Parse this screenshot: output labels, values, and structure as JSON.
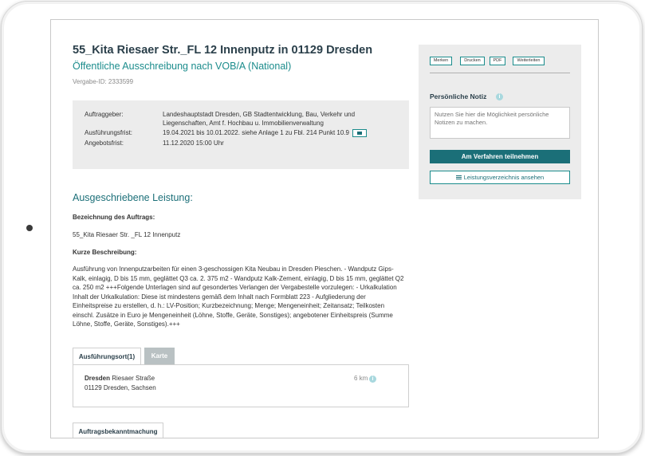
{
  "header": {
    "title": "55_Kita Riesaer Str._FL 12 Innenputz in 01129 Dresden",
    "subtitle": "Öffentliche Ausschreibung nach VOB/A (National)",
    "vergabe_id": "Vergabe-ID: 2333599"
  },
  "info": {
    "auftraggeber_label": "Auftraggeber:",
    "auftraggeber_line1": "Landeshauptstadt Dresden, GB Stadtentwicklung, Bau, Verkehr und",
    "auftraggeber_line2": "Liegenschaften, Amt f. Hochbau u. Immobilienverwaltung",
    "frist_label": "Ausführungsfrist:",
    "frist_value": "19.04.2021 bis 10.01.2022. siehe Anlage 1 zu Fbl. 214 Punkt 10.9",
    "angebot_label": "Angebotsfrist:",
    "angebot_value": "11.12.2020 15:00 Uhr"
  },
  "leistung": {
    "section_title": "Ausgeschriebene Leistung:",
    "bezeichnung_label": "Bezeichnung des Auftrags:",
    "bezeichnung_value": "55_Kita Riesaer Str. _FL 12 Innenputz",
    "kurz_label": "Kurze Beschreibung:",
    "kurz_text": "Ausführung von Innenputzarbeiten für einen 3-geschossigen Kita Neubau in Dresden Pieschen. - Wandputz Gips-Kalk, einlagig, D bis 15 mm, geglättet Q3 ca. 2. 375 m2 - Wandputz Kalk-Zement, einlagig, D bis 15 mm, geglättet Q2 ca. 250 m2 +++Folgende Unterlagen sind auf gesondertes Verlangen der Vergabestelle vorzulegen: - Urkalkulation Inhalt der Urkalkulation: Diese ist mindestens gemäß dem Inhalt nach Formblatt 223 - Aufgliederung der Einheitspreise zu erstellen, d. h.: LV-Position; Kurzbezeichnung; Menge; Mengeneinheit; Zeitansatz; Teilkosten einschl. Zusätze in Euro je Mengeneinheit (Löhne, Stoffe, Geräte, Sonstiges); angebotener Einheitspreis (Summe Löhne, Stoffe, Geräte, Sonstiges).+++"
  },
  "tabs": {
    "ort": "Ausführungsort(1)",
    "karte": "Karte"
  },
  "location": {
    "city": "Dresden",
    "street": "Riesaer Straße",
    "zip_line": "01129 Dresden, Sachsen",
    "distance": "6 km"
  },
  "bekannt_tab": "Auftragsbekanntmachung",
  "sidebar": {
    "actions": [
      "Merken",
      "Drucken",
      "PDF",
      "Weiterleiten"
    ],
    "notiz_title": "Persönliche Notiz",
    "notiz_placeholder": "Nutzen Sie hier die Möglichkeit persönliche Notizen zu machen.",
    "primary_button": "Am Verfahren teilnehmen",
    "secondary_button": "Leistungsverzeichnis ansehen"
  },
  "icons": {
    "info": "info-icon",
    "calendar": "calendar-icon",
    "list": "list-icon"
  },
  "colors": {
    "accent": "#1b6f78",
    "teal_text": "#1b8c8c",
    "panel_bg": "#ececec"
  }
}
